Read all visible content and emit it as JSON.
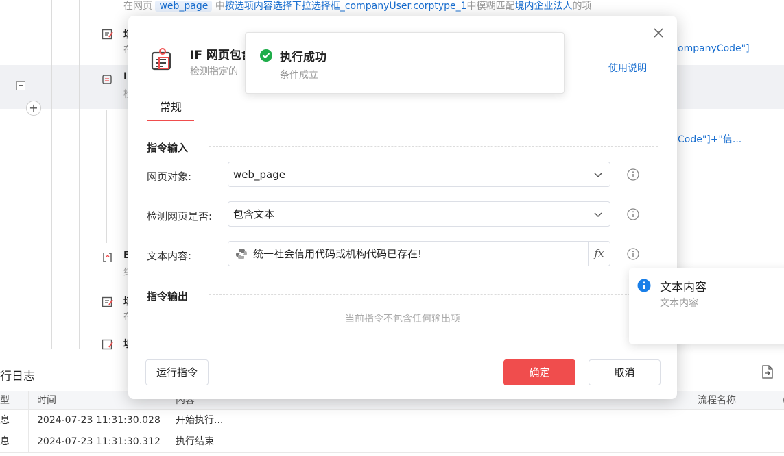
{
  "background": {
    "rows": [
      {
        "prefix": "在网页",
        "chip": "web_page",
        "mid1": "中",
        "link1": "按选项内容选择下拉选择框_companyUser.corptype_1",
        "mid2": "中模糊匹配",
        "link2": "境内企业法人",
        "tail": "的项"
      },
      {
        "title": "填",
        "desc": "在",
        "right": "ompanyCode\"]"
      },
      {
        "title": "I",
        "desc": "检"
      },
      {
        "right": "Code\"]+\"信..."
      },
      {
        "title": "E",
        "desc": "结"
      },
      {
        "title": "填",
        "desc": "在"
      },
      {
        "title": "填"
      }
    ]
  },
  "log": {
    "title": "行日志",
    "columns": [
      "型",
      "时间",
      "内容",
      "流程名称",
      "("
    ],
    "rows": [
      {
        "type": "息",
        "time": "2024-07-23 11:31:30.028",
        "content": "开始执行..."
      },
      {
        "type": "息",
        "time": "2024-07-23 11:31:30.312",
        "content": "执行结束"
      }
    ]
  },
  "dialog": {
    "title": "IF 网页包含",
    "subtitle": "检测指定的",
    "help_link": "使用说明",
    "tab": "常规",
    "input_section": "指令输入",
    "output_section": "指令输出",
    "fields": {
      "page_object": {
        "label": "网页对象:",
        "value": "web_page"
      },
      "detect": {
        "label": "检测网页是否:",
        "value": "包含文本"
      },
      "text": {
        "label": "文本内容:",
        "value": "统一社会信用代码或机构代码已存在!",
        "fx": "fx"
      }
    },
    "no_output": "当前指令不包含任何输出项",
    "buttons": {
      "run": "运行指令",
      "ok": "确定",
      "cancel": "取消"
    }
  },
  "toast": {
    "title": "执行成功",
    "message": "条件成立",
    "color": "#1fad4a"
  },
  "tooltip": {
    "title": "文本内容",
    "subtitle": "文本内容",
    "color": "#1a7fe8"
  },
  "colors": {
    "accent": "#f04d4d",
    "link": "#1a6fd0"
  }
}
